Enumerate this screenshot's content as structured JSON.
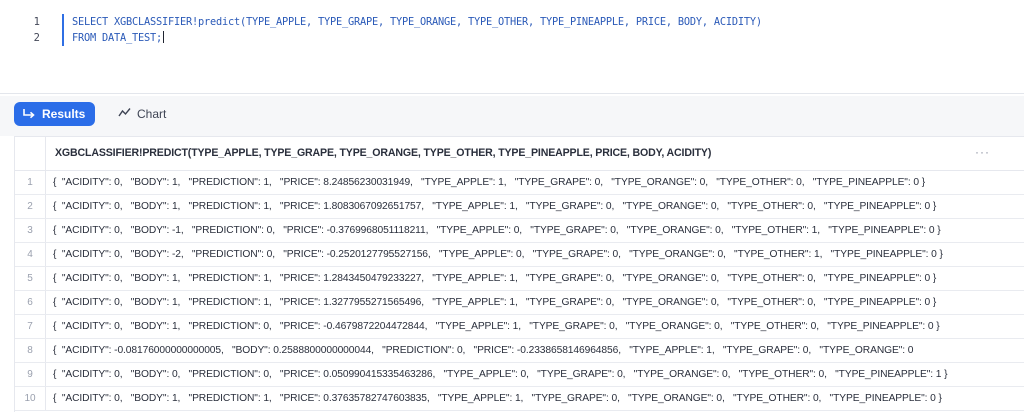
{
  "editor": {
    "lines": [
      {
        "number": "1",
        "text": "SELECT XGBCLASSIFIER!predict(TYPE_APPLE, TYPE_GRAPE, TYPE_ORANGE, TYPE_OTHER, TYPE_PINEAPPLE, PRICE, BODY, ACIDITY)"
      },
      {
        "number": "2",
        "text": "FROM DATA_TEST;"
      }
    ],
    "accent_color": "#2f6fe4"
  },
  "tabs": {
    "results_label": "Results",
    "chart_label": "Chart",
    "results_icon": "return-arrow-icon",
    "chart_icon": "line-chart-icon"
  },
  "grid": {
    "column_header": "XGBCLASSIFIER!PREDICT(TYPE_APPLE, TYPE_GRAPE, TYPE_ORANGE, TYPE_OTHER, TYPE_PINEAPPLE, PRICE, BODY, ACIDITY)",
    "column_menu": "···",
    "rows": [
      {
        "num": "1",
        "value": "{  \"ACIDITY\": 0,   \"BODY\": 1,   \"PREDICTION\": 1,   \"PRICE\": 8.24856230031949,   \"TYPE_APPLE\": 1,   \"TYPE_GRAPE\": 0,   \"TYPE_ORANGE\": 0,   \"TYPE_OTHER\": 0,   \"TYPE_PINEAPPLE\": 0 }"
      },
      {
        "num": "2",
        "value": "{  \"ACIDITY\": 0,   \"BODY\": 1,   \"PREDICTION\": 1,   \"PRICE\": 1.8083067092651757,   \"TYPE_APPLE\": 1,   \"TYPE_GRAPE\": 0,   \"TYPE_ORANGE\": 0,   \"TYPE_OTHER\": 0,   \"TYPE_PINEAPPLE\": 0 }"
      },
      {
        "num": "3",
        "value": "{  \"ACIDITY\": 0,   \"BODY\": -1,   \"PREDICTION\": 0,   \"PRICE\": -0.3769968051118211,   \"TYPE_APPLE\": 0,   \"TYPE_GRAPE\": 0,   \"TYPE_ORANGE\": 0,   \"TYPE_OTHER\": 1,   \"TYPE_PINEAPPLE\": 0 }"
      },
      {
        "num": "4",
        "value": "{  \"ACIDITY\": 0,   \"BODY\": -2,   \"PREDICTION\": 0,   \"PRICE\": -0.2520127795527156,   \"TYPE_APPLE\": 0,   \"TYPE_GRAPE\": 0,   \"TYPE_ORANGE\": 0,   \"TYPE_OTHER\": 1,   \"TYPE_PINEAPPLE\": 0 }"
      },
      {
        "num": "5",
        "value": "{  \"ACIDITY\": 0,   \"BODY\": 1,   \"PREDICTION\": 1,   \"PRICE\": 1.2843450479233227,   \"TYPE_APPLE\": 1,   \"TYPE_GRAPE\": 0,   \"TYPE_ORANGE\": 0,   \"TYPE_OTHER\": 0,   \"TYPE_PINEAPPLE\": 0 }"
      },
      {
        "num": "6",
        "value": "{  \"ACIDITY\": 0,   \"BODY\": 1,   \"PREDICTION\": 1,   \"PRICE\": 1.3277955271565496,   \"TYPE_APPLE\": 1,   \"TYPE_GRAPE\": 0,   \"TYPE_ORANGE\": 0,   \"TYPE_OTHER\": 0,   \"TYPE_PINEAPPLE\": 0 }"
      },
      {
        "num": "7",
        "value": "{  \"ACIDITY\": 0,   \"BODY\": 1,   \"PREDICTION\": 0,   \"PRICE\": -0.4679872204472844,   \"TYPE_APPLE\": 1,   \"TYPE_GRAPE\": 0,   \"TYPE_ORANGE\": 0,   \"TYPE_OTHER\": 0,   \"TYPE_PINEAPPLE\": 0 }"
      },
      {
        "num": "8",
        "value": "{  \"ACIDITY\": -0.08176000000000005,   \"BODY\": 0.2588800000000044,   \"PREDICTION\": 0,   \"PRICE\": -0.2338658146964856,   \"TYPE_APPLE\": 1,   \"TYPE_GRAPE\": 0,   \"TYPE_ORANGE\": 0"
      },
      {
        "num": "9",
        "value": "{  \"ACIDITY\": 0,   \"BODY\": 0,   \"PREDICTION\": 0,   \"PRICE\": 0.050990415335463286,   \"TYPE_APPLE\": 0,   \"TYPE_GRAPE\": 0,   \"TYPE_ORANGE\": 0,   \"TYPE_OTHER\": 0,   \"TYPE_PINEAPPLE\": 1 }"
      },
      {
        "num": "10",
        "value": "{  \"ACIDITY\": 0,   \"BODY\": 1,   \"PREDICTION\": 1,   \"PRICE\": 0.37635782747603835,   \"TYPE_APPLE\": 1,   \"TYPE_GRAPE\": 0,   \"TYPE_ORANGE\": 0,   \"TYPE_OTHER\": 0,   \"TYPE_PINEAPPLE\": 0 }"
      }
    ]
  }
}
